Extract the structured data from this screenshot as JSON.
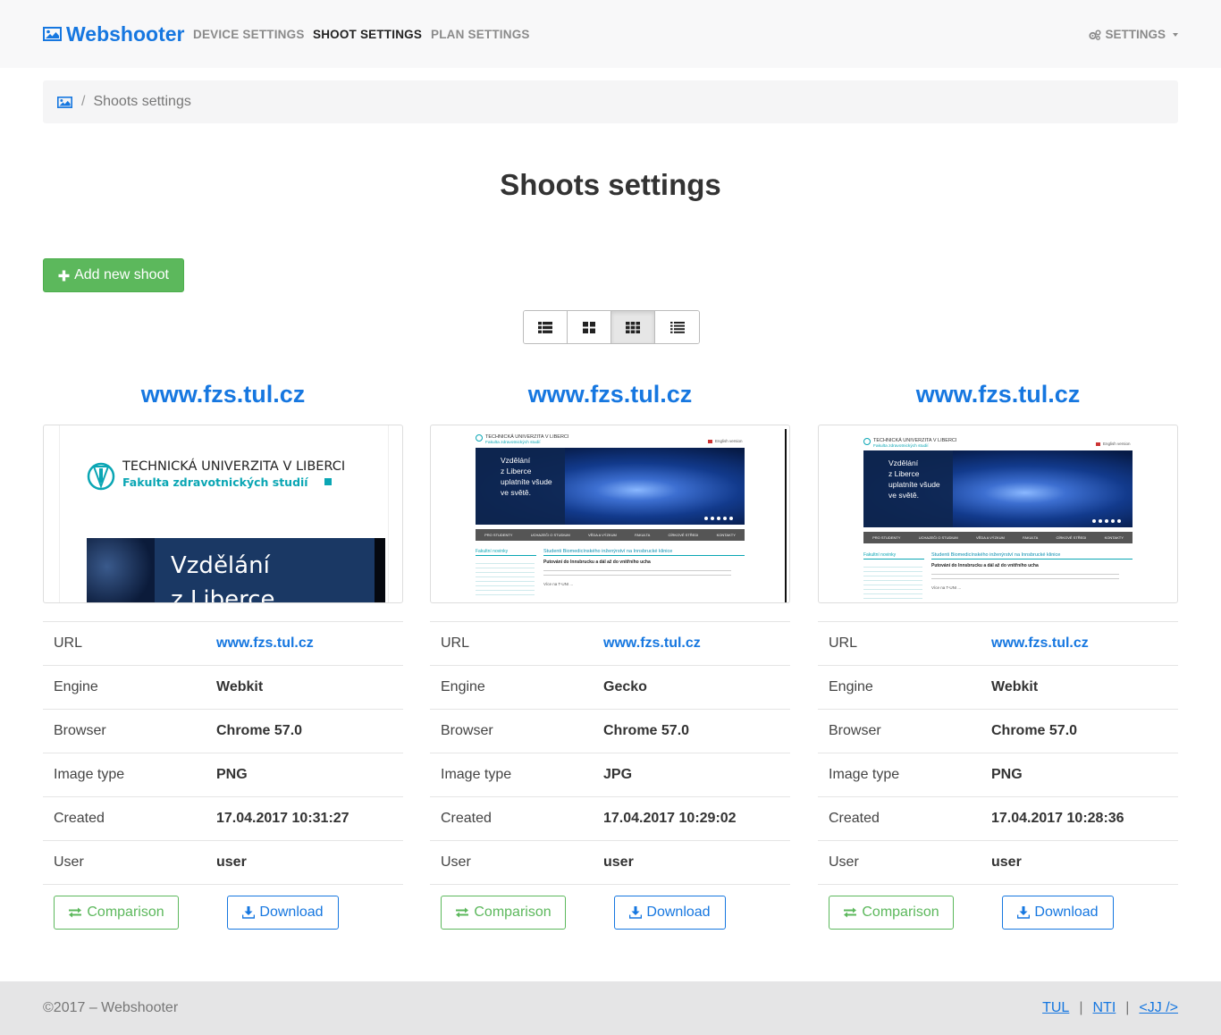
{
  "navbar": {
    "brand": "Webshooter",
    "links": [
      {
        "label": "DEVICE SETTINGS",
        "active": false
      },
      {
        "label": "SHOOT SETTINGS",
        "active": true
      },
      {
        "label": "PLAN SETTINGS",
        "active": false
      }
    ],
    "settings_label": "SETTINGS"
  },
  "breadcrumb": {
    "home_icon": "image-icon",
    "separator": "/",
    "current": "Shoots settings"
  },
  "page": {
    "title": "Shoots settings",
    "add_button": "Add new shoot"
  },
  "view_switch": {
    "buttons": [
      {
        "icon": "list-icon",
        "active": false
      },
      {
        "icon": "large-grid-icon",
        "active": false
      },
      {
        "icon": "small-grid-icon",
        "active": true
      },
      {
        "icon": "list-detail-icon",
        "active": false
      }
    ]
  },
  "shoots": [
    {
      "title": "www.fzs.tul.cz",
      "thumb": {
        "uni_name": "TECHNICKÁ UNIVERZITA V LIBERCI",
        "faculty": "Fakulta zdravotnických studií",
        "banner_line1": "Vzdělání",
        "banner_line2": "z Liberce"
      },
      "rows": [
        {
          "label": "URL",
          "value": "www.fzs.tul.cz"
        },
        {
          "label": "Engine",
          "value": "Webkit"
        },
        {
          "label": "Browser",
          "value": "Chrome 57.0"
        },
        {
          "label": "Image type",
          "value": "PNG"
        },
        {
          "label": "Created",
          "value": "17.04.2017 10:31:27"
        },
        {
          "label": "User",
          "value": "user"
        }
      ],
      "compare_label": "Comparison",
      "download_label": "Download"
    },
    {
      "title": "www.fzs.tul.cz",
      "thumb": {
        "uni_name": "TECHNICKÁ UNIVERZITA V LIBERCI",
        "faculty": "Fakulta zdravotnických studií",
        "english": "English version",
        "banner": [
          "Vzdělání",
          "z Liberce",
          "uplatníte všude",
          "ve světě."
        ],
        "menu": [
          "PRO STUDENTY",
          "UCHAZEČI O STUDIUM",
          "VĚDA A VÝZKUM",
          "FAKULTA",
          "CÍRKOVÉ STŘEDI",
          "KONTAKTY"
        ],
        "news_heading": "Fakultní novinky",
        "article_title": "Studenti Biomedicínského inženýrství na Innsbrucké klinice",
        "article_subtitle": "Putování do Innsbrucku a dál až do vnitřního ucha",
        "more": "Více na T-UNI ..."
      },
      "rows": [
        {
          "label": "URL",
          "value": "www.fzs.tul.cz"
        },
        {
          "label": "Engine",
          "value": "Gecko"
        },
        {
          "label": "Browser",
          "value": "Chrome 57.0"
        },
        {
          "label": "Image type",
          "value": "JPG"
        },
        {
          "label": "Created",
          "value": "17.04.2017 10:29:02"
        },
        {
          "label": "User",
          "value": "user"
        }
      ],
      "compare_label": "Comparison",
      "download_label": "Download"
    },
    {
      "title": "www.fzs.tul.cz",
      "thumb": {
        "uni_name": "TECHNICKÁ UNIVERZITA V LIBERCI",
        "faculty": "Fakulta zdravotnických studií",
        "english": "English version",
        "banner": [
          "Vzdělání",
          "z Liberce",
          "uplatníte všude",
          "ve světě."
        ],
        "menu": [
          "PRO STUDENTY",
          "UCHAZEČI O STUDIUM",
          "VĚDA A VÝZKUM",
          "FAKULTA",
          "CÍRKOVÉ STŘEDI",
          "KONTAKTY"
        ],
        "news_heading": "Fakultní novinky",
        "article_title": "Studenti Biomedicínského inženýrství na Innsbrucké klinice",
        "article_subtitle": "Putování do Innsbrucku a dál až do vnitřního ucha",
        "more": "Více na T-UNI ..."
      },
      "rows": [
        {
          "label": "URL",
          "value": "www.fzs.tul.cz"
        },
        {
          "label": "Engine",
          "value": "Webkit"
        },
        {
          "label": "Browser",
          "value": "Chrome 57.0"
        },
        {
          "label": "Image type",
          "value": "PNG"
        },
        {
          "label": "Created",
          "value": "17.04.2017 10:28:36"
        },
        {
          "label": "User",
          "value": "user"
        }
      ],
      "compare_label": "Comparison",
      "download_label": "Download"
    }
  ],
  "footer": {
    "copyright": "©2017 – Webshooter",
    "separator": "|",
    "links": [
      "TUL",
      "NTI",
      "<JJ />"
    ]
  },
  "colors": {
    "accent": "#1677e0",
    "success": "#5cb85c",
    "navbar_bg": "#f8f8f9",
    "footer_bg": "#e5e5e6"
  }
}
